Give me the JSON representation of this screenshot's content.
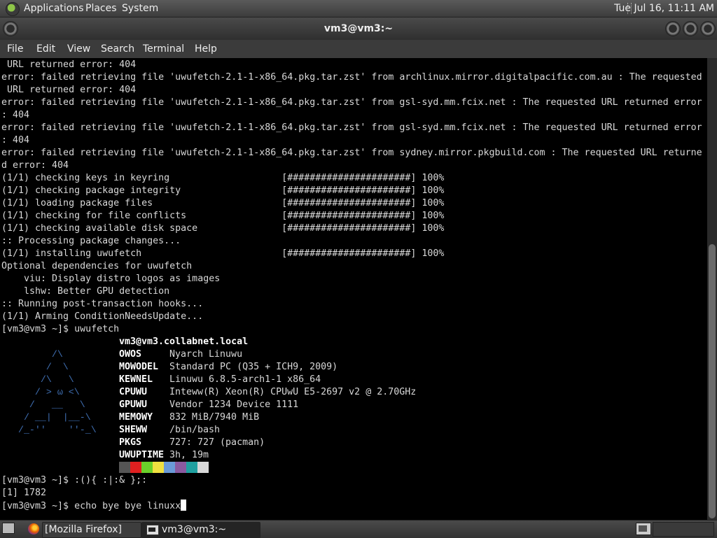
{
  "top_panel": {
    "menus": [
      "Applications",
      "Places",
      "System"
    ],
    "clock": "Tue Jul 16, 11:11 AM"
  },
  "window": {
    "title": "vm3@vm3:~",
    "menu": [
      "File",
      "Edit",
      "View",
      "Search",
      "Terminal",
      "Help"
    ]
  },
  "terminal": {
    "lines": [
      " URL returned error: 404",
      "error: failed retrieving file 'uwufetch-2.1-1-x86_64.pkg.tar.zst' from archlinux.mirror.digitalpacific.com.au : The requested",
      " URL returned error: 404",
      "error: failed retrieving file 'uwufetch-2.1-1-x86_64.pkg.tar.zst' from gsl-syd.mm.fcix.net : The requested URL returned error",
      ": 404",
      "error: failed retrieving file 'uwufetch-2.1-1-x86_64.pkg.tar.zst' from gsl-syd.mm.fcix.net : The requested URL returned error",
      ": 404",
      "error: failed retrieving file 'uwufetch-2.1-1-x86_64.pkg.tar.zst' from sydney.mirror.pkgbuild.com : The requested URL returne",
      "d error: 404",
      "(1/1) checking keys in keyring                    [######################] 100%",
      "(1/1) checking package integrity                  [######################] 100%",
      "(1/1) loading package files                       [######################] 100%",
      "(1/1) checking for file conflicts                 [######################] 100%",
      "(1/1) checking available disk space               [######################] 100%",
      ":: Processing package changes...",
      "(1/1) installing uwufetch                         [######################] 100%",
      "Optional dependencies for uwufetch",
      "    viu: Display distro logos as images",
      "    lshw: Better GPU detection",
      ":: Running post-transaction hooks...",
      "(1/1) Arming ConditionNeedsUpdate...",
      "[vm3@vm3 ~]$ uwufetch"
    ],
    "fetch": {
      "header": "vm3@vm3.collabnet.local",
      "logo": "        /\\\n       /  \\\n      /\\   \\\n     / > ω <\\\n    /   __   \\\n   / __|  |__-\\\n  /_-''    ''-_\\",
      "rows": [
        {
          "key": "OWOS",
          "value": "Nyarch Linuwu"
        },
        {
          "key": "MOWODEL",
          "value": "Standard PC (Q35 + ICH9, 2009)"
        },
        {
          "key": "KEWNEL",
          "value": "Linuwu 6.8.5-arch1-1 x86_64"
        },
        {
          "key": "CPUWU",
          "value": "Inteww(R) Xeon(R) CPUwU E5-2697 v2 @ 2.70GHz"
        },
        {
          "key": "GPUWU",
          "value": "Vendor 1234 Device 1111"
        },
        {
          "key": "MEMOWY",
          "value": "832 MiB/7940 MiB"
        },
        {
          "key": "SHEWW",
          "value": "/bin/bash"
        },
        {
          "key": "PKGS",
          "value": "727: 727 (pacman)"
        },
        {
          "key": "UWUPTIME",
          "value": "3h, 19m"
        }
      ],
      "palette": [
        "#555555",
        "#e02020",
        "#6ad02a",
        "#f0e040",
        "#6a9ad8",
        "#8a5aa0",
        "#20a0a0",
        "#d8d8d8"
      ]
    },
    "after_lines": [
      "[vm3@vm3 ~]$ :(){ :|:& };:",
      "[1] 1782"
    ],
    "prompt": "[vm3@vm3 ~]$ echo bye bye linuxx"
  },
  "taskbar": {
    "tasks": [
      {
        "label": "[Mozilla Firefox]",
        "icon": "firefox-icon",
        "active": false
      },
      {
        "label": "vm3@vm3:~",
        "icon": "terminal-icon",
        "active": true
      }
    ]
  }
}
